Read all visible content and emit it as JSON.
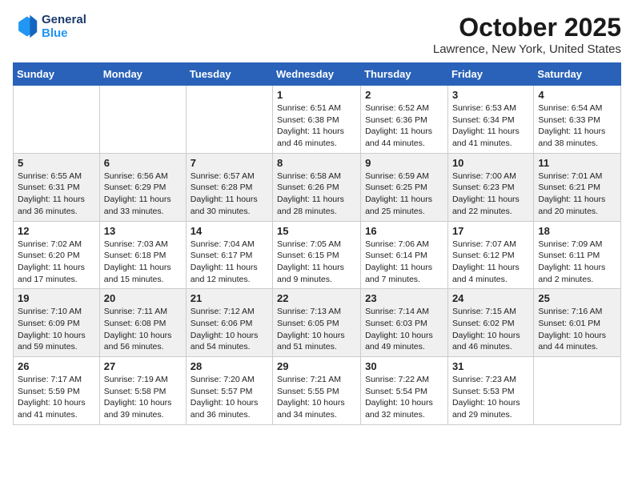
{
  "logo": {
    "line1": "General",
    "line2": "Blue"
  },
  "title": "October 2025",
  "location": "Lawrence, New York, United States",
  "days_of_week": [
    "Sunday",
    "Monday",
    "Tuesday",
    "Wednesday",
    "Thursday",
    "Friday",
    "Saturday"
  ],
  "weeks": [
    [
      {
        "day": "",
        "info": ""
      },
      {
        "day": "",
        "info": ""
      },
      {
        "day": "",
        "info": ""
      },
      {
        "day": "1",
        "info": "Sunrise: 6:51 AM\nSunset: 6:38 PM\nDaylight: 11 hours\nand 46 minutes."
      },
      {
        "day": "2",
        "info": "Sunrise: 6:52 AM\nSunset: 6:36 PM\nDaylight: 11 hours\nand 44 minutes."
      },
      {
        "day": "3",
        "info": "Sunrise: 6:53 AM\nSunset: 6:34 PM\nDaylight: 11 hours\nand 41 minutes."
      },
      {
        "day": "4",
        "info": "Sunrise: 6:54 AM\nSunset: 6:33 PM\nDaylight: 11 hours\nand 38 minutes."
      }
    ],
    [
      {
        "day": "5",
        "info": "Sunrise: 6:55 AM\nSunset: 6:31 PM\nDaylight: 11 hours\nand 36 minutes."
      },
      {
        "day": "6",
        "info": "Sunrise: 6:56 AM\nSunset: 6:29 PM\nDaylight: 11 hours\nand 33 minutes."
      },
      {
        "day": "7",
        "info": "Sunrise: 6:57 AM\nSunset: 6:28 PM\nDaylight: 11 hours\nand 30 minutes."
      },
      {
        "day": "8",
        "info": "Sunrise: 6:58 AM\nSunset: 6:26 PM\nDaylight: 11 hours\nand 28 minutes."
      },
      {
        "day": "9",
        "info": "Sunrise: 6:59 AM\nSunset: 6:25 PM\nDaylight: 11 hours\nand 25 minutes."
      },
      {
        "day": "10",
        "info": "Sunrise: 7:00 AM\nSunset: 6:23 PM\nDaylight: 11 hours\nand 22 minutes."
      },
      {
        "day": "11",
        "info": "Sunrise: 7:01 AM\nSunset: 6:21 PM\nDaylight: 11 hours\nand 20 minutes."
      }
    ],
    [
      {
        "day": "12",
        "info": "Sunrise: 7:02 AM\nSunset: 6:20 PM\nDaylight: 11 hours\nand 17 minutes."
      },
      {
        "day": "13",
        "info": "Sunrise: 7:03 AM\nSunset: 6:18 PM\nDaylight: 11 hours\nand 15 minutes."
      },
      {
        "day": "14",
        "info": "Sunrise: 7:04 AM\nSunset: 6:17 PM\nDaylight: 11 hours\nand 12 minutes."
      },
      {
        "day": "15",
        "info": "Sunrise: 7:05 AM\nSunset: 6:15 PM\nDaylight: 11 hours\nand 9 minutes."
      },
      {
        "day": "16",
        "info": "Sunrise: 7:06 AM\nSunset: 6:14 PM\nDaylight: 11 hours\nand 7 minutes."
      },
      {
        "day": "17",
        "info": "Sunrise: 7:07 AM\nSunset: 6:12 PM\nDaylight: 11 hours\nand 4 minutes."
      },
      {
        "day": "18",
        "info": "Sunrise: 7:09 AM\nSunset: 6:11 PM\nDaylight: 11 hours\nand 2 minutes."
      }
    ],
    [
      {
        "day": "19",
        "info": "Sunrise: 7:10 AM\nSunset: 6:09 PM\nDaylight: 10 hours\nand 59 minutes."
      },
      {
        "day": "20",
        "info": "Sunrise: 7:11 AM\nSunset: 6:08 PM\nDaylight: 10 hours\nand 56 minutes."
      },
      {
        "day": "21",
        "info": "Sunrise: 7:12 AM\nSunset: 6:06 PM\nDaylight: 10 hours\nand 54 minutes."
      },
      {
        "day": "22",
        "info": "Sunrise: 7:13 AM\nSunset: 6:05 PM\nDaylight: 10 hours\nand 51 minutes."
      },
      {
        "day": "23",
        "info": "Sunrise: 7:14 AM\nSunset: 6:03 PM\nDaylight: 10 hours\nand 49 minutes."
      },
      {
        "day": "24",
        "info": "Sunrise: 7:15 AM\nSunset: 6:02 PM\nDaylight: 10 hours\nand 46 minutes."
      },
      {
        "day": "25",
        "info": "Sunrise: 7:16 AM\nSunset: 6:01 PM\nDaylight: 10 hours\nand 44 minutes."
      }
    ],
    [
      {
        "day": "26",
        "info": "Sunrise: 7:17 AM\nSunset: 5:59 PM\nDaylight: 10 hours\nand 41 minutes."
      },
      {
        "day": "27",
        "info": "Sunrise: 7:19 AM\nSunset: 5:58 PM\nDaylight: 10 hours\nand 39 minutes."
      },
      {
        "day": "28",
        "info": "Sunrise: 7:20 AM\nSunset: 5:57 PM\nDaylight: 10 hours\nand 36 minutes."
      },
      {
        "day": "29",
        "info": "Sunrise: 7:21 AM\nSunset: 5:55 PM\nDaylight: 10 hours\nand 34 minutes."
      },
      {
        "day": "30",
        "info": "Sunrise: 7:22 AM\nSunset: 5:54 PM\nDaylight: 10 hours\nand 32 minutes."
      },
      {
        "day": "31",
        "info": "Sunrise: 7:23 AM\nSunset: 5:53 PM\nDaylight: 10 hours\nand 29 minutes."
      },
      {
        "day": "",
        "info": ""
      }
    ]
  ]
}
